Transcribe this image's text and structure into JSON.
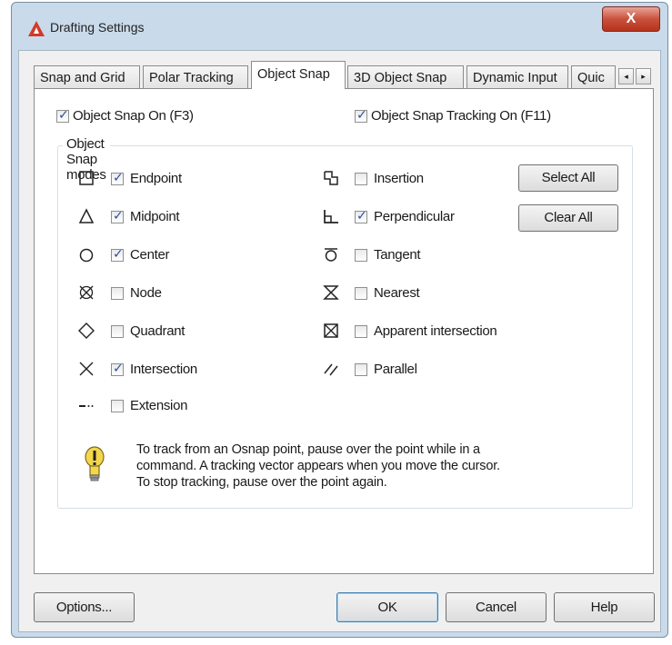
{
  "window": {
    "title": "Drafting Settings",
    "close_label": "X"
  },
  "tabs": [
    {
      "label": "Snap and Grid"
    },
    {
      "label": "Polar Tracking"
    },
    {
      "label": "Object Snap"
    },
    {
      "label": "3D Object Snap"
    },
    {
      "label": "Dynamic Input"
    },
    {
      "label": "Quic"
    }
  ],
  "tab_scroll": {
    "left": "◂",
    "right": "▸"
  },
  "top_options": {
    "osnap_on": {
      "label": "Object Snap On (F3)",
      "checked": true
    },
    "tracking_on": {
      "label": "Object Snap Tracking On (F11)",
      "checked": true
    }
  },
  "modes_group": {
    "title": "Object Snap modes"
  },
  "modes_left": [
    {
      "label": "Endpoint",
      "checked": true,
      "icon": "square-icon"
    },
    {
      "label": "Midpoint",
      "checked": true,
      "icon": "triangle-icon"
    },
    {
      "label": "Center",
      "checked": true,
      "icon": "circle-icon"
    },
    {
      "label": "Node",
      "checked": false,
      "icon": "node-icon"
    },
    {
      "label": "Quadrant",
      "checked": false,
      "icon": "diamond-icon"
    },
    {
      "label": "Intersection",
      "checked": true,
      "icon": "x-icon"
    },
    {
      "label": "Extension",
      "checked": false,
      "icon": "extension-icon"
    }
  ],
  "modes_right": [
    {
      "label": "Insertion",
      "checked": false,
      "icon": "insertion-icon"
    },
    {
      "label": "Perpendicular",
      "checked": true,
      "icon": "perpendicular-icon"
    },
    {
      "label": "Tangent",
      "checked": false,
      "icon": "tangent-icon"
    },
    {
      "label": "Nearest",
      "checked": false,
      "icon": "hourglass-icon"
    },
    {
      "label": "Apparent intersection",
      "checked": false,
      "icon": "boxed-x-icon"
    },
    {
      "label": "Parallel",
      "checked": false,
      "icon": "parallel-icon"
    }
  ],
  "side_buttons": {
    "select_all": "Select All",
    "clear_all": "Clear All"
  },
  "note": {
    "lines": [
      "To track from an Osnap point, pause over the point while in a",
      "command.  A tracking vector appears when you move the cursor.",
      "To stop tracking, pause over the point again."
    ],
    "icon": "lightbulb-icon"
  },
  "footer": {
    "options": "Options...",
    "ok": "OK",
    "cancel": "Cancel",
    "help": "Help"
  },
  "colors": {
    "title_bar": "#c9daea",
    "close_button": "#c9513c",
    "check_mark": "#2b4f9e",
    "bulb": "#f4d64a"
  }
}
